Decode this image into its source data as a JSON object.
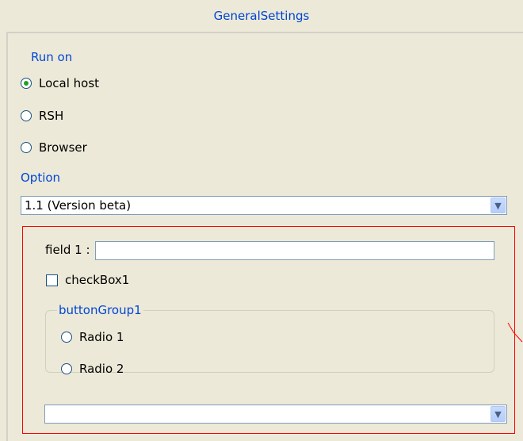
{
  "panel": {
    "title": "GeneralSettings"
  },
  "run_on": {
    "label": "Run on",
    "options": [
      {
        "label": "Local host",
        "checked": true
      },
      {
        "label": "RSH",
        "checked": false
      },
      {
        "label": "Browser",
        "checked": false
      }
    ]
  },
  "option": {
    "label": "Option",
    "selected": "1.1 (Version beta)"
  },
  "form": {
    "field1_label": "field 1 :",
    "field1_value": "",
    "checkbox_label": "checkBox1",
    "checkbox_checked": false,
    "group_title": "buttonGroup1",
    "group_radios": [
      {
        "label": "Radio 1",
        "checked": false
      },
      {
        "label": "Radio 2",
        "checked": false
      }
    ],
    "bottom_select_value": ""
  },
  "icons": {
    "dropdown": "chevron-down-icon"
  },
  "colors": {
    "accent_text": "#0046d5",
    "highlight_border": "#ff0000",
    "background": "#ece9d8"
  }
}
